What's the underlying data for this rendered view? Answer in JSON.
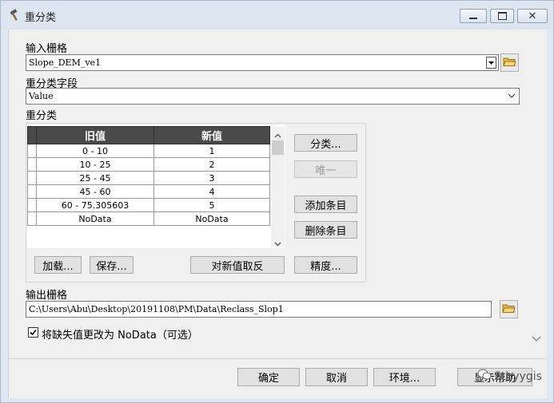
{
  "window": {
    "title": "重分类"
  },
  "input_raster": {
    "label": "输入栅格",
    "value": "Slope_DEM_ve1"
  },
  "reclass_field": {
    "label": "重分类字段",
    "value": "Value"
  },
  "reclassification": {
    "label": "重分类",
    "columns": [
      "旧值",
      "新值"
    ],
    "rows": [
      [
        "0 - 10",
        "1"
      ],
      [
        "10 - 25",
        "2"
      ],
      [
        "25 - 45",
        "3"
      ],
      [
        "45 - 60",
        "4"
      ],
      [
        "60 - 75.305603",
        "5"
      ],
      [
        "NoData",
        "NoData"
      ]
    ],
    "buttons": {
      "classify": "分类...",
      "unique": "唯一",
      "add_entry": "添加条目",
      "delete_entry": "删除条目",
      "load": "加载...",
      "save": "保存...",
      "reverse": "对新值取反",
      "precision": "精度..."
    }
  },
  "output_raster": {
    "label": "输出栅格",
    "value": "C:\\Users\\Abu\\Desktop\\20191108\\PM\\Data\\Reclass_Slop1"
  },
  "nodata_option": {
    "label": "将缺失值更改为 NoData（可选）",
    "checked": true
  },
  "footer": {
    "ok": "确定",
    "cancel": "取消",
    "environments": "环境...",
    "show_help": "显示帮助"
  },
  "watermark": "Sthyygis"
}
